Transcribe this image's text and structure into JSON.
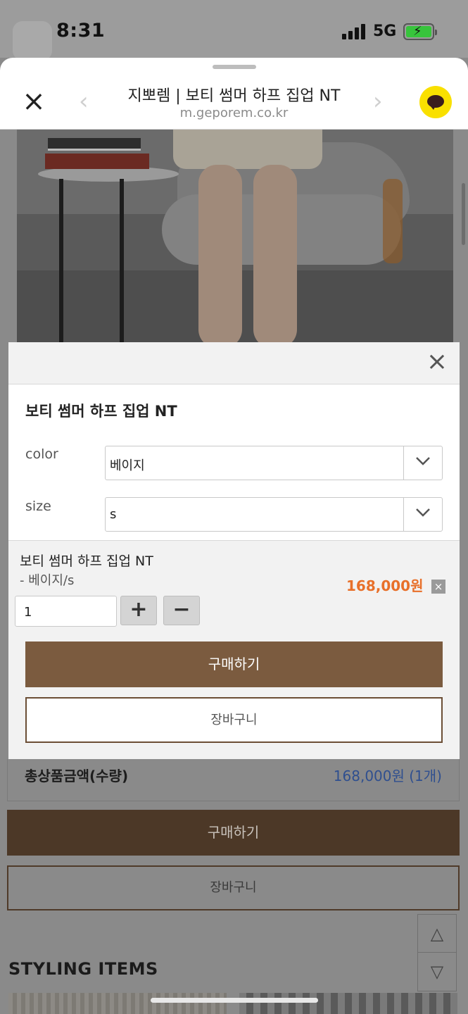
{
  "status_bar": {
    "time": "8:31",
    "network": "5G",
    "battery_state": "charging"
  },
  "header": {
    "title": "지뽀렘 | 보티 썸머 하프 집업 NT",
    "url": "m.geporem.co.kr",
    "close_icon": "close-icon",
    "back_icon": "chevron-left-icon",
    "forward_icon": "chevron-right-icon",
    "kakao_icon": "kakao-chat-icon"
  },
  "option_modal": {
    "product_title": "보티 썸머 하프 집업 NT",
    "options": [
      {
        "label": "color",
        "value": "베이지"
      },
      {
        "label": "size",
        "value": "s"
      }
    ],
    "selected_item": {
      "name": "보티 썸머 하프 집업 NT",
      "option": "- 베이지/s",
      "price": "168,000원",
      "quantity": "1",
      "plus_label": "+",
      "minus_label": "−",
      "remove_label": "×"
    },
    "buy_label": "구매하기",
    "cart_label": "장바구니"
  },
  "page": {
    "total_label": "총상품금액(수량)",
    "total_value": "168,000원 (1개)",
    "buy_label": "구매하기",
    "cart_label": "장바구니",
    "styling_title": "STYLING ITEMS",
    "scroll_up": "△",
    "scroll_down": "▽"
  },
  "colors": {
    "brand_brown": "#7b5b3f",
    "price_orange": "#e8702a",
    "total_blue": "#2f4f8f",
    "kakao_yellow": "#f9e000"
  }
}
